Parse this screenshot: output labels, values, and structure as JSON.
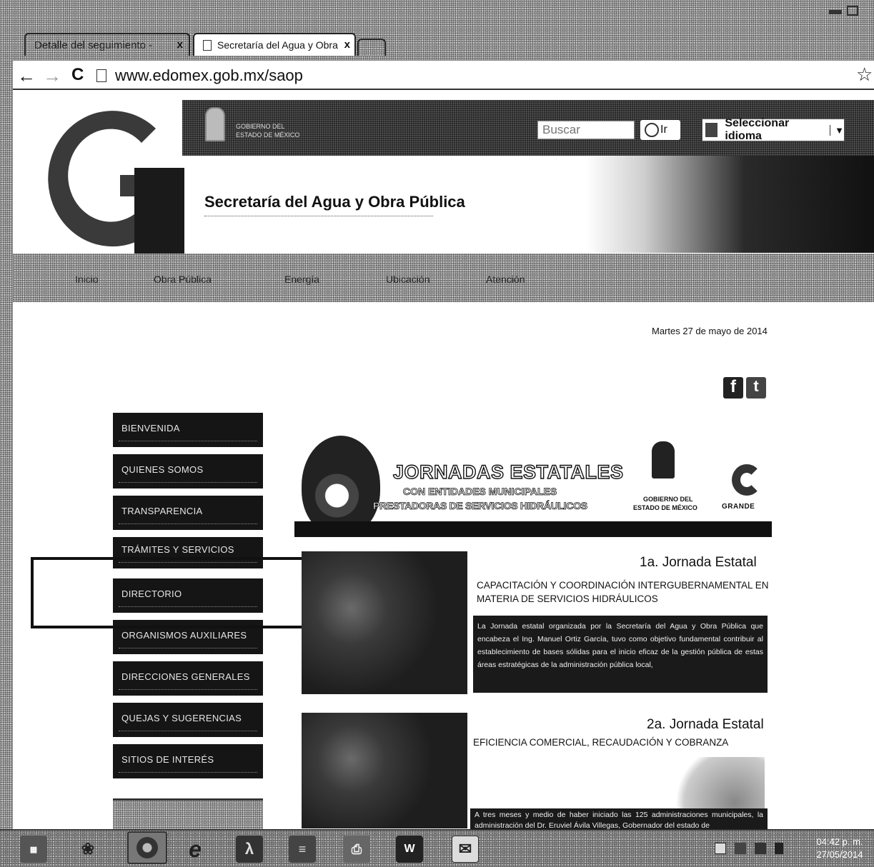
{
  "browser": {
    "tabs": [
      {
        "label": "Detalle del seguimiento - ",
        "close": "x"
      },
      {
        "label": "Secretaría del Agua y Obra",
        "close": "x"
      }
    ],
    "url": "www.edomex.gob.mx/saop",
    "nav_icons": [
      "back-arrow-icon",
      "forward-arrow-icon",
      "reload-icon",
      "page-icon",
      "star-icon"
    ]
  },
  "header": {
    "gov_line1": "GOBIERNO DEL",
    "gov_line2": "ESTADO DE MÉXICO",
    "search_placeholder": "Buscar",
    "search_button": "Ir",
    "language_label": "Seleccionar idioma",
    "site_title": "Secretaría del Agua y Obra Pública"
  },
  "nav": [
    "Inicio",
    "Obra Pública",
    "Energía",
    "Ubicación",
    "Atención"
  ],
  "date": "Martes 27 de mayo de 2014",
  "social": {
    "facebook": "f",
    "twitter": "t"
  },
  "sidebar": [
    "BIENVENIDA",
    "QUIENES SOMOS",
    "TRANSPARENCIA",
    "TRÁMITES Y SERVICIOS",
    "DIRECTORIO",
    "ORGANISMOS AUXILIARES",
    "DIRECCIONES GENERALES",
    "QUEJAS Y SUGERENCIAS",
    "SITIOS DE INTERÉS"
  ],
  "banner": {
    "title": "JORNADAS ESTATALES",
    "line2": "CON ENTIDADES MUNICIPALES",
    "line3": "PRESTADORAS DE SERVICIOS HIDRÁULICOS",
    "gov_line1": "GOBIERNO DEL",
    "gov_line2": "ESTADO DE MÉXICO",
    "grande": "GRANDE"
  },
  "articles": [
    {
      "heading": "1a. Jornada Estatal",
      "subtitle": "CAPACITACIÓN Y COORDINACIÓN INTERGUBERNAMENTAL EN MATERIA DE SERVICIOS HIDRÁULICOS",
      "text": "La Jornada estatal organizada por la Secretaría del Agua y Obra Pública que encabeza el Ing. Manuel Ortiz García, tuvo como objetivo fundamental contribuir al establecimiento de bases sólidas para el inicio eficaz de la gestión pública de estas áreas estratégicas de la administración pública local,"
    },
    {
      "heading": "2a. Jornada Estatal",
      "subtitle": "EFICIENCIA COMERCIAL, RECAUDACIÓN Y COBRANZA",
      "text": "A tres meses y medio de haber iniciado las 125 administraciones municipales, la administración del Dr. Eruviel Ávila Villegas, Gobernador del estado de"
    }
  ],
  "taskbar": {
    "time": "04:42 p. m.",
    "date": "27/05/2014",
    "icons": [
      "windows-start-icon",
      "paint-icon",
      "chrome-icon",
      "internet-explorer-icon",
      "acrobat-icon",
      "notepad-icon",
      "printer-icon",
      "word-icon",
      "outlook-icon"
    ]
  }
}
